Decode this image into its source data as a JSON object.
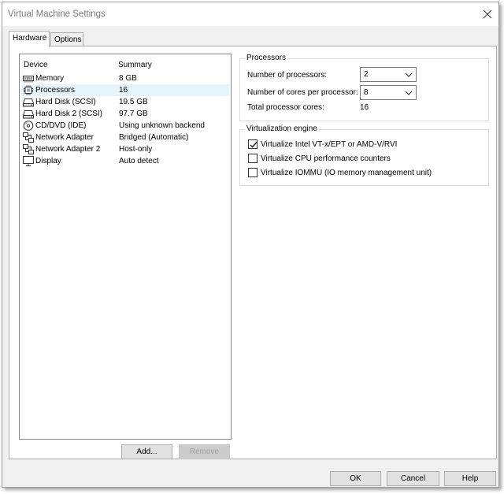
{
  "window": {
    "title": "Virtual Machine Settings"
  },
  "tabs": [
    {
      "label": "Hardware",
      "active": true
    },
    {
      "label": "Options",
      "active": false
    }
  ],
  "device_list": {
    "headers": {
      "device": "Device",
      "summary": "Summary"
    },
    "rows": [
      {
        "icon": "memory-icon",
        "device": "Memory",
        "summary": "8 GB"
      },
      {
        "icon": "processor-icon",
        "device": "Processors",
        "summary": "16",
        "selected": true
      },
      {
        "icon": "hard-disk-icon",
        "device": "Hard Disk (SCSI)",
        "summary": "19.5 GB"
      },
      {
        "icon": "hard-disk-icon",
        "device": "Hard Disk 2 (SCSI)",
        "summary": "97.7 GB"
      },
      {
        "icon": "cd-dvd-icon",
        "device": "CD/DVD (IDE)",
        "summary": "Using unknown backend"
      },
      {
        "icon": "network-adapter-icon",
        "device": "Network Adapter",
        "summary": "Bridged (Automatic)"
      },
      {
        "icon": "network-adapter-icon",
        "device": "Network Adapter 2",
        "summary": "Host-only"
      },
      {
        "icon": "display-icon",
        "device": "Display",
        "summary": "Auto detect"
      }
    ],
    "add_label": "Add...",
    "remove_label": "Remove"
  },
  "processors": {
    "title": "Processors",
    "num_processors_label": "Number of processors:",
    "num_processors_value": "2",
    "cores_label": "Number of cores per processor:",
    "cores_value": "8",
    "total_label": "Total processor cores:",
    "total_value": "16"
  },
  "virtualization": {
    "title": "Virtualization engine",
    "options": [
      {
        "label": "Virtualize Intel VT-x/EPT or AMD-V/RVI",
        "checked": true
      },
      {
        "label": "Virtualize CPU performance counters",
        "checked": false
      },
      {
        "label": "Virtualize IOMMU (IO memory management unit)",
        "checked": false
      }
    ]
  },
  "footer": {
    "ok_label": "OK",
    "cancel_label": "Cancel",
    "help_label": "Help"
  },
  "colors": {
    "selected_row": "#e5f3fb",
    "dialog_bg": "#f0f0f0",
    "button_bg": "#e1e1e1"
  }
}
